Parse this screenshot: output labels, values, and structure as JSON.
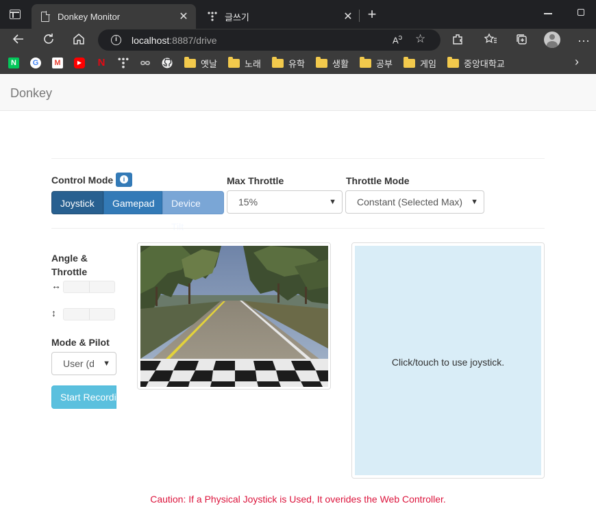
{
  "browser": {
    "tabs": [
      {
        "title": "Donkey Monitor",
        "active": true
      },
      {
        "title": "글쓰기",
        "active": false
      }
    ],
    "url_host": "localhost",
    "url_path": ":8887/drive",
    "bookmarks": [
      {
        "label": "옛날"
      },
      {
        "label": "노래"
      },
      {
        "label": "유학"
      },
      {
        "label": "생활"
      },
      {
        "label": "공부"
      },
      {
        "label": "게임"
      },
      {
        "label": "중앙대학교"
      }
    ],
    "bookmark_icons": {
      "naver": {
        "text": "N",
        "color": "#03c75a"
      },
      "google": {
        "text": "G"
      },
      "gmail": {
        "text": "M"
      },
      "youtube": {
        "text": "▶"
      },
      "netflix": {
        "text": "N"
      }
    }
  },
  "page": {
    "brand": "Donkey",
    "control_mode": {
      "label": "Control Mode",
      "buttons": [
        "Joystick",
        "Gamepad",
        "Device Tilt"
      ],
      "selected": "Joystick"
    },
    "max_throttle": {
      "label": "Max Throttle",
      "value": "15%"
    },
    "throttle_mode": {
      "label": "Throttle Mode",
      "value": "Constant (Selected Max)"
    },
    "angle_throttle_label": [
      "Angle &",
      "Throttle"
    ],
    "angle_icon": "↔",
    "throttle_icon": "↕",
    "mode_pilot": {
      "label": "Mode & Pilot",
      "value": "User (d"
    },
    "record_button": "Start Recording",
    "joystick_prompt": "Click/touch to use joystick.",
    "caution": "Caution: If a Physical Joystick is Used, It overides the Web Controller."
  },
  "colors": {
    "primary": "#337ab7",
    "primary_active": "#286090",
    "info": "#5bc0de",
    "joystick_bg": "#d9edf7",
    "caution": "#dc143c"
  }
}
